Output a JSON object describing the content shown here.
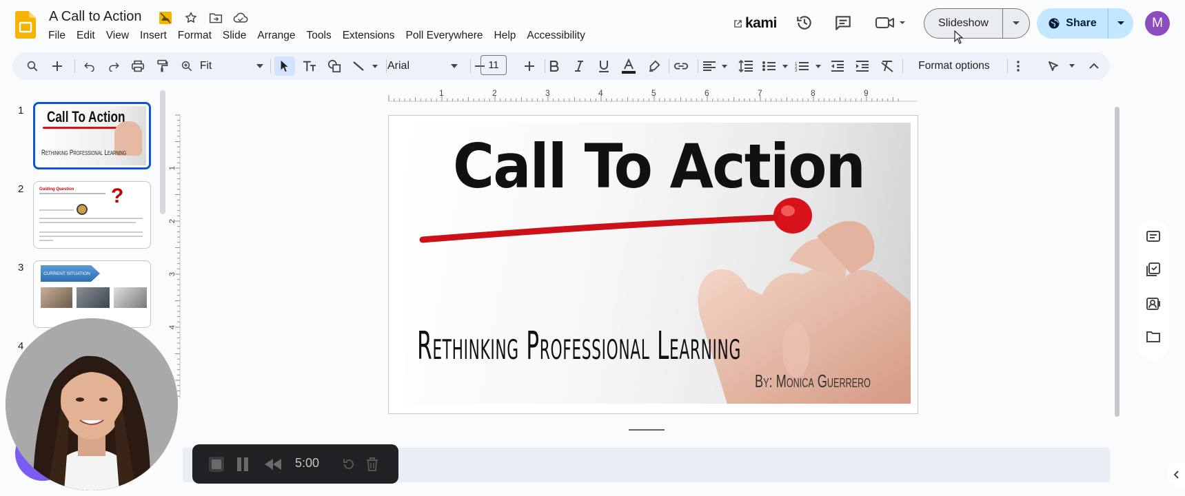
{
  "app": {
    "doc_title": "A Call to Action",
    "menu": [
      "File",
      "Edit",
      "View",
      "Insert",
      "Format",
      "Slide",
      "Arrange",
      "Tools",
      "Extensions",
      "Poll Everywhere",
      "Help",
      "Accessibility"
    ],
    "kami_label": "kami",
    "slideshow_label": "Slideshow",
    "share_label": "Share",
    "avatar_initial": "M",
    "brand_color": "#f4b400",
    "accent_color": "#0b57d0"
  },
  "toolbar": {
    "zoom": "Fit",
    "font": "Arial",
    "font_size": "11",
    "format_options": "Format options",
    "icons": [
      "search-icon",
      "plus-icon",
      "undo-icon",
      "redo-icon",
      "print-icon",
      "paint-format-icon",
      "zoom-icon",
      "select-icon",
      "text-box-icon",
      "shape-icon",
      "line-icon",
      "bold-icon",
      "italic-icon",
      "underline-icon",
      "text-color-icon",
      "highlight-icon",
      "link-icon",
      "align-icon",
      "line-spacing-icon",
      "bullet-list-icon",
      "numbered-list-icon",
      "indent-decrease-icon",
      "indent-increase-icon",
      "clear-format-icon",
      "more-icon",
      "pen-icon",
      "collapse-icon"
    ]
  },
  "filmstrip": {
    "slides": [
      {
        "number": "1",
        "title": "Call To Action",
        "subtitle": "Rethinking Professional Learning"
      },
      {
        "number": "2",
        "heading": "Guiding Question"
      },
      {
        "number": "3",
        "banner": "CURRENT SITUATION"
      },
      {
        "number": "4"
      }
    ]
  },
  "ruler": {
    "horizontal": [
      "1",
      "2",
      "3",
      "4",
      "5",
      "6",
      "7",
      "8",
      "9"
    ],
    "vertical": [
      "1",
      "2",
      "3",
      "4"
    ]
  },
  "slide": {
    "title": "Call To Action",
    "subtitle": "Rethinking Professional Learning",
    "author": "By: Monica Guerrero"
  },
  "timer": {
    "value": "5:00"
  }
}
